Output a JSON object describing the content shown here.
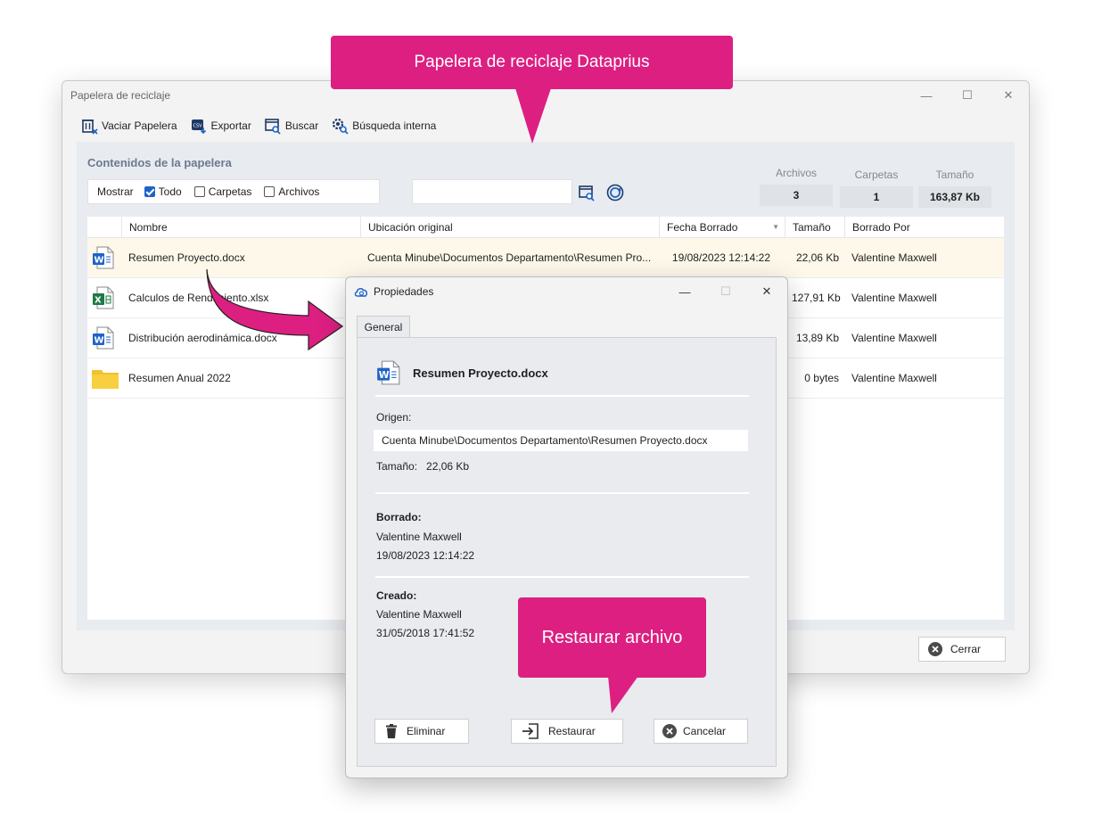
{
  "window": {
    "title": "Papelera de reciclaje"
  },
  "toolbar": {
    "empty": "Vaciar Papelera",
    "export": "Exportar",
    "search": "Buscar",
    "internal_search": "Búsqueda interna"
  },
  "panel": {
    "title": "Contenidos de la papelera",
    "show_label": "Mostrar",
    "filter_all": "Todo",
    "filter_folders": "Carpetas",
    "filter_files": "Archivos",
    "search_value": ""
  },
  "stats": {
    "files_label": "Archivos",
    "files_value": "3",
    "folders_label": "Carpetas",
    "folders_value": "1",
    "size_label": "Tamaño",
    "size_value": "163,87 Kb"
  },
  "table": {
    "headers": [
      "Nombre",
      "Ubicación original",
      "Fecha Borrado",
      "Tamaño",
      "Borrado Por"
    ],
    "rows": [
      {
        "icon": "word-icon",
        "name": "Resumen Proyecto.docx",
        "location": "Cuenta Minube\\Documentos Departamento\\Resumen Pro...",
        "date": "19/08/2023 12:14:22",
        "size": "22,06 Kb",
        "by": "Valentine Maxwell"
      },
      {
        "icon": "excel-icon",
        "name": "Calculos de Rendimiento.xlsx",
        "location": "",
        "date": "",
        "size": "127,91 Kb",
        "by": "Valentine Maxwell"
      },
      {
        "icon": "word-icon",
        "name": "Distribución aerodinámica.docx",
        "location": "",
        "date": "",
        "size": "13,89 Kb",
        "by": "Valentine Maxwell"
      },
      {
        "icon": "folder-icon",
        "name": "Resumen Anual 2022",
        "location": "",
        "date": "",
        "size": "0 bytes",
        "by": "Valentine Maxwell"
      }
    ]
  },
  "close_button": "Cerrar",
  "callouts": {
    "top": "Papelera de reciclaje Dataprius",
    "bottom": "Restaurar archivo"
  },
  "dialog": {
    "title": "Propiedades",
    "tab": "General",
    "file_name": "Resumen Proyecto.docx",
    "origin_label": "Origen:",
    "origin_value": "Cuenta Minube\\Documentos Departamento\\Resumen Proyecto.docx",
    "size_label": "Tamaño:",
    "size_value": "22,06 Kb",
    "deleted_label": "Borrado:",
    "deleted_by": "Valentine Maxwell",
    "deleted_date": "19/08/2023 12:14:22",
    "created_label": "Creado:",
    "created_by": "Valentine Maxwell",
    "created_date": "31/05/2018 17:41:52",
    "btn_delete": "Eliminar",
    "btn_restore": "Restaurar",
    "btn_cancel": "Cancelar"
  },
  "colors": {
    "accent": "#dd1f82",
    "word": "#1e63c8",
    "excel": "#1d7a45",
    "folder": "#f2c12e"
  }
}
